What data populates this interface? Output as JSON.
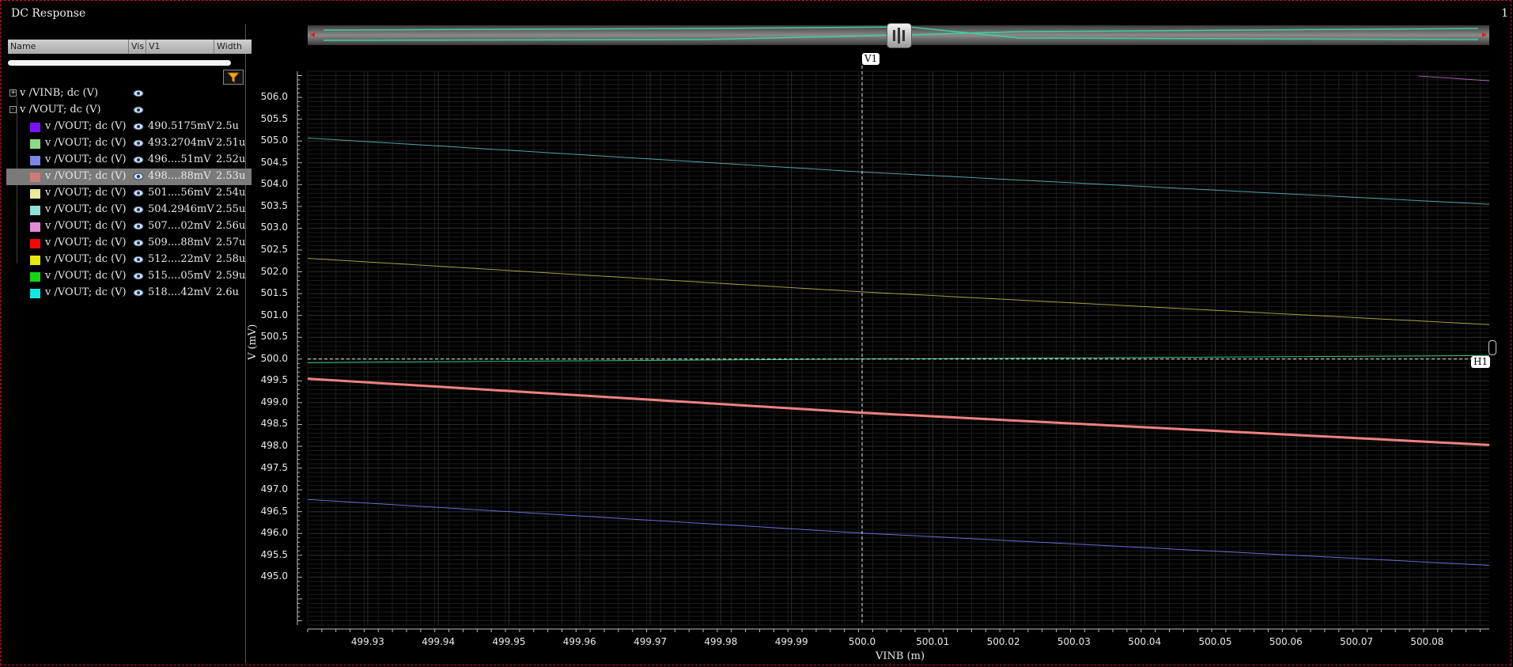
{
  "window": {
    "title": "DC Response",
    "page_number": "1"
  },
  "table": {
    "headers": {
      "name": "Name",
      "vis": "Vis",
      "v1": "V1",
      "width": "Width"
    },
    "groups": [
      {
        "label": "v /VINB; dc (V)",
        "expander": "+"
      },
      {
        "label": "v /VOUT; dc (V)",
        "expander": "-"
      }
    ],
    "rows": [
      {
        "label": "v /VOUT; dc (V)",
        "v1": "490.5175mV",
        "width": "2.5u",
        "color": "#7a12f5"
      },
      {
        "label": "v /VOUT; dc (V)",
        "v1": "493.2704mV",
        "width": "2.51u",
        "color": "#8ed889"
      },
      {
        "label": "v /VOUT; dc (V)",
        "v1": "496....51mV",
        "width": "2.52u",
        "color": "#7b86e8"
      },
      {
        "label": "v /VOUT; dc (V)",
        "v1": "498....88mV",
        "width": "2.53u",
        "color": "#cc7a7a",
        "selected": true
      },
      {
        "label": "v /VOUT; dc (V)",
        "v1": "501....56mV",
        "width": "2.54u",
        "color": "#ece89c"
      },
      {
        "label": "v /VOUT; dc (V)",
        "v1": "504.2946mV",
        "width": "2.55u",
        "color": "#8fe0d8"
      },
      {
        "label": "v /VOUT; dc (V)",
        "v1": "507....02mV",
        "width": "2.56u",
        "color": "#e08ad8"
      },
      {
        "label": "v /VOUT; dc (V)",
        "v1": "509....88mV",
        "width": "2.57u",
        "color": "#f00a0a"
      },
      {
        "label": "v /VOUT; dc (V)",
        "v1": "512....22mV",
        "width": "2.58u",
        "color": "#e6e610"
      },
      {
        "label": "v /VOUT; dc (V)",
        "v1": "515....05mV",
        "width": "2.59u",
        "color": "#14d414"
      },
      {
        "label": "v /VOUT; dc (V)",
        "v1": "518....42mV",
        "width": "2.6u",
        "color": "#14e6e6"
      }
    ]
  },
  "markers": {
    "vertical": "V1",
    "horizontal": "H1"
  },
  "chart_data": {
    "type": "line",
    "xlabel": "VINB (m)",
    "ylabel": "V (mV)",
    "xlim": [
      499.9215,
      500.0888
    ],
    "ylim": [
      493.9,
      506.6
    ],
    "x_ticks": [
      "499.93",
      "499.94",
      "499.95",
      "499.96",
      "499.97",
      "499.98",
      "499.99",
      "500.0",
      "500.01",
      "500.02",
      "500.03",
      "500.04",
      "500.05",
      "500.06",
      "500.07",
      "500.08"
    ],
    "y_ticks": [
      "506.0",
      "505.5",
      "505.0",
      "504.5",
      "504.0",
      "503.5",
      "503.0",
      "502.5",
      "502.0",
      "501.5",
      "501.0",
      "500.5",
      "500.0",
      "499.5",
      "499.0",
      "498.5",
      "498.0",
      "497.5",
      "497.0",
      "496.5",
      "496.0",
      "495.5",
      "495.0"
    ],
    "cursor_x": 500.0,
    "cursor_y": 500.0,
    "series": [
      {
        "color": "#6a6ad8",
        "width": 1,
        "x": [
          499.9215,
          500.0,
          500.0888
        ],
        "values": [
          496.78,
          496.01,
          495.27
        ]
      },
      {
        "color": "#f08080",
        "width": 3,
        "x": [
          499.9215,
          500.0,
          500.0888
        ],
        "values": [
          499.55,
          498.77,
          498.03
        ]
      },
      {
        "color": "#2fcf7a",
        "width": 1,
        "x": [
          499.9215,
          500.0,
          500.0888
        ],
        "values": [
          499.92,
          500.0,
          500.08
        ]
      },
      {
        "color": "#a0a040",
        "width": 1,
        "x": [
          499.9215,
          500.0,
          500.0888
        ],
        "values": [
          502.31,
          501.54,
          500.79
        ]
      },
      {
        "color": "#4fa0a8",
        "width": 1,
        "x": [
          499.9215,
          500.0,
          500.0888
        ],
        "values": [
          505.07,
          504.29,
          503.55
        ]
      },
      {
        "color": "#b060b8",
        "width": 1,
        "x": [
          500.0788,
          500.0888
        ],
        "values": [
          506.49,
          506.38
        ]
      }
    ]
  }
}
